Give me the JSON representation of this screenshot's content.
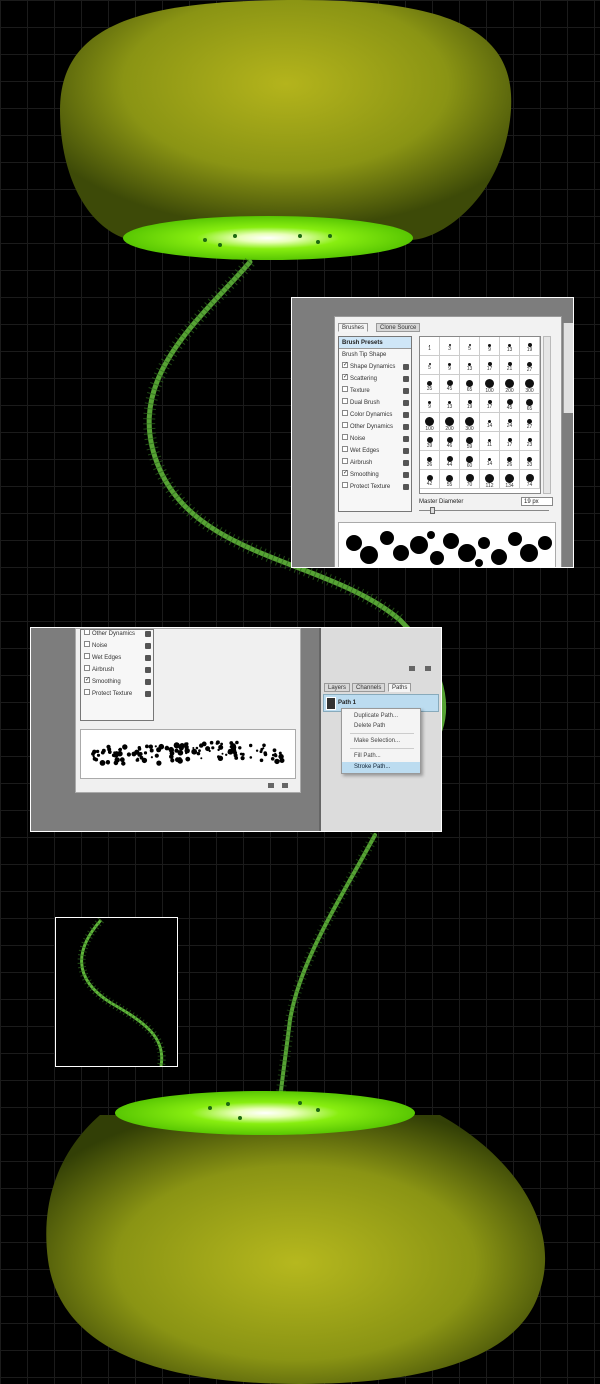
{
  "brushes_panel": {
    "tabs": [
      "Brushes",
      "Clone Source"
    ],
    "brush_presets": "Brush Presets",
    "brush_tip_shape": "Brush Tip Shape",
    "options": [
      {
        "label": "Shape Dynamics",
        "checked": true
      },
      {
        "label": "Scattering",
        "checked": true
      },
      {
        "label": "Texture",
        "checked": false
      },
      {
        "label": "Dual Brush",
        "checked": false
      },
      {
        "label": "Color Dynamics",
        "checked": false
      },
      {
        "label": "Other Dynamics",
        "checked": false
      },
      {
        "label": "Noise",
        "checked": false
      },
      {
        "label": "Wet Edges",
        "checked": false
      },
      {
        "label": "Airbrush",
        "checked": false
      },
      {
        "label": "Smoothing",
        "checked": true
      },
      {
        "label": "Protect Texture",
        "checked": false
      }
    ],
    "brush_sizes": [
      "1",
      "3",
      "5",
      "9",
      "13",
      "19",
      "5",
      "9",
      "13",
      "17",
      "21",
      "27",
      "35",
      "45",
      "65",
      "100",
      "200",
      "300",
      "9",
      "13",
      "19",
      "17",
      "45",
      "65",
      "100",
      "200",
      "300",
      "14",
      "24",
      "27",
      "39",
      "46",
      "59",
      "11",
      "17",
      "23",
      "36",
      "44",
      "60",
      "14",
      "26",
      "33",
      "42",
      "55",
      "70",
      "112",
      "134",
      "74"
    ],
    "master_diameter_label": "Master Diameter",
    "master_diameter_value": "19 px"
  },
  "second_panel": {
    "options": [
      {
        "label": "Other Dynamics",
        "checked": false
      },
      {
        "label": "Noise",
        "checked": false
      },
      {
        "label": "Wet Edges",
        "checked": false
      },
      {
        "label": "Airbrush",
        "checked": false
      },
      {
        "label": "Smoothing",
        "checked": true
      },
      {
        "label": "Protect Texture",
        "checked": false
      }
    ],
    "tabs": [
      "Layers",
      "Channels",
      "Paths"
    ],
    "path_name": "Path 1",
    "context_menu": [
      "Duplicate Path...",
      "Delete Path",
      "Make Selection...",
      "Fill Path...",
      "Stroke Path..."
    ]
  },
  "colors": {
    "kiwi_flesh": "#7fe000",
    "kiwi_skin": "#8a9a10",
    "stroke_green": "#5fb53a"
  }
}
